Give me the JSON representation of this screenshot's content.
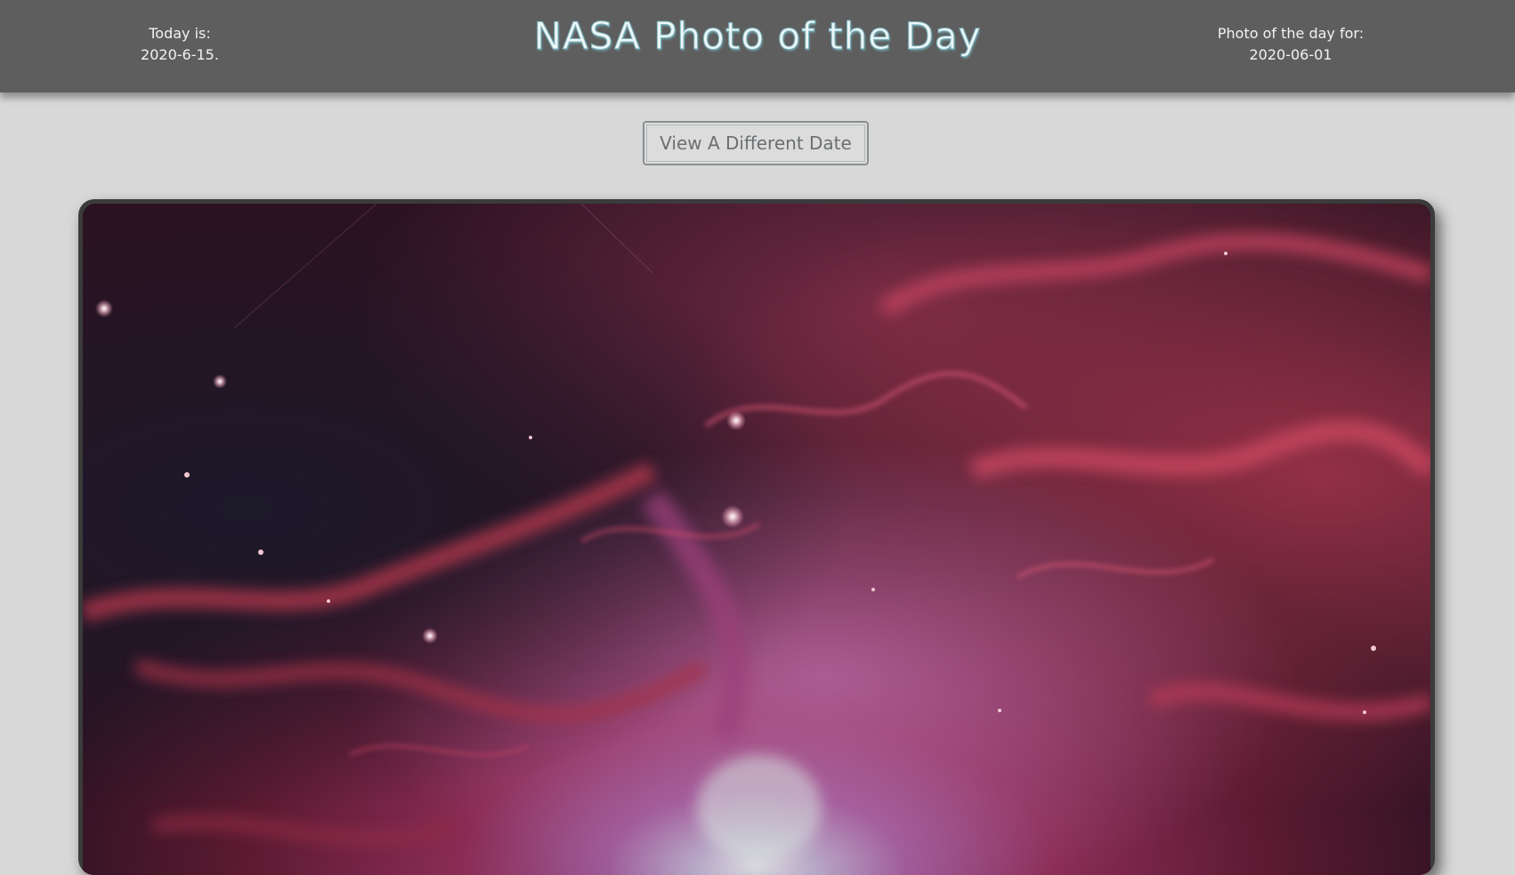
{
  "header": {
    "today_label": "Today is:",
    "today_value": "2020-6-15.",
    "title": "NASA Photo of the Day",
    "photo_date_label": "Photo of the day for:",
    "photo_date_value": "2020-06-01"
  },
  "controls": {
    "different_date_button": "View A Different Date"
  },
  "colors": {
    "header_bg": "#5e5e5e",
    "page_bg": "#d8d8d8",
    "title_color": "#eef6f6"
  }
}
